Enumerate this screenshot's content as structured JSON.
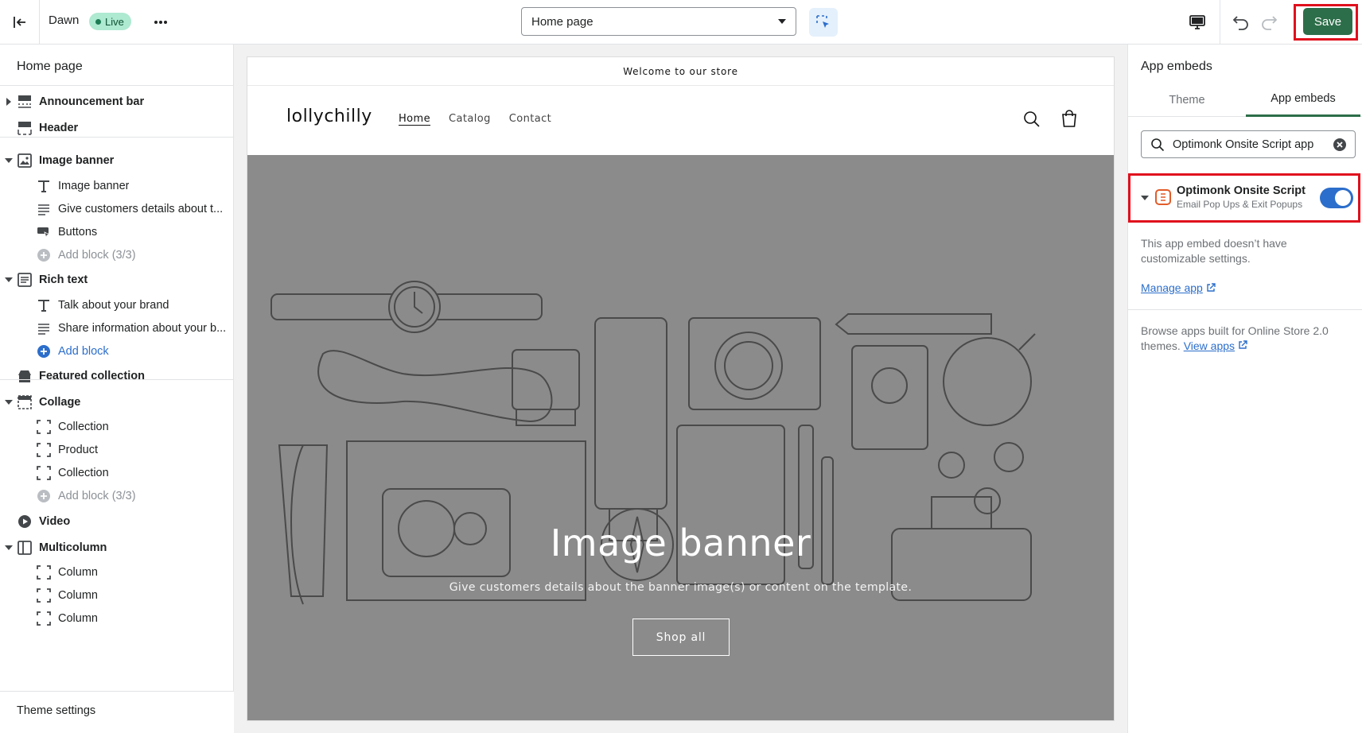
{
  "topbar": {
    "theme_name": "Dawn",
    "status_badge": "Live",
    "page_selector": "Home page",
    "save_label": "Save"
  },
  "sidebar": {
    "title": "Home page",
    "items": [
      {
        "type": "section",
        "label": "Announcement bar",
        "icon": "announcement-bar-icon",
        "arrow": "right"
      },
      {
        "type": "section",
        "label": "Header",
        "icon": "header-icon"
      },
      {
        "type": "section",
        "label": "Image banner",
        "icon": "image-icon",
        "arrow": "down"
      },
      {
        "type": "block",
        "label": "Image banner",
        "icon": "text-icon"
      },
      {
        "type": "block",
        "label": "Give customers details about t...",
        "icon": "paragraph-icon"
      },
      {
        "type": "block",
        "label": "Buttons",
        "icon": "buttons-icon"
      },
      {
        "type": "add",
        "label": "Add block (3/3)",
        "icon": "add-circle-icon"
      },
      {
        "type": "section",
        "label": "Rich text",
        "icon": "rich-text-icon",
        "arrow": "down"
      },
      {
        "type": "block",
        "label": "Talk about your brand",
        "icon": "text-icon"
      },
      {
        "type": "block",
        "label": "Share information about your b...",
        "icon": "paragraph-icon"
      },
      {
        "type": "add-active",
        "label": "Add block",
        "icon": "add-circle-icon"
      },
      {
        "type": "section",
        "label": "Featured collection",
        "icon": "featured-collection-icon"
      },
      {
        "type": "section",
        "label": "Collage",
        "icon": "collage-icon",
        "arrow": "down"
      },
      {
        "type": "block",
        "label": "Collection",
        "icon": "frame-icon"
      },
      {
        "type": "block",
        "label": "Product",
        "icon": "frame-icon"
      },
      {
        "type": "block",
        "label": "Collection",
        "icon": "frame-icon"
      },
      {
        "type": "add",
        "label": "Add block (3/3)",
        "icon": "add-circle-icon"
      },
      {
        "type": "section",
        "label": "Video",
        "icon": "video-icon"
      },
      {
        "type": "section",
        "label": "Multicolumn",
        "icon": "multicolumn-icon",
        "arrow": "down"
      },
      {
        "type": "block",
        "label": "Column",
        "icon": "frame-icon"
      },
      {
        "type": "block",
        "label": "Column",
        "icon": "frame-icon"
      },
      {
        "type": "block",
        "label": "Column",
        "icon": "frame-icon"
      }
    ],
    "theme_settings": "Theme settings"
  },
  "preview": {
    "announcement": "Welcome to our store",
    "store_logo": "lollychilly",
    "nav": [
      "Home",
      "Catalog",
      "Contact"
    ],
    "banner_heading": "Image banner",
    "banner_subtext": "Give customers details about the banner image(s) or content on the template.",
    "banner_button": "Shop all"
  },
  "right_panel": {
    "title": "App embeds",
    "tabs": [
      "Theme",
      "App embeds"
    ],
    "active_tab": "App embeds",
    "search_value": "Optimonk Onsite Script app",
    "embed": {
      "name": "Optimonk Onsite Script",
      "subtitle": "Email Pop Ups & Exit Popups",
      "enabled": true
    },
    "embed_info": "This app embed doesn’t have customizable settings.",
    "manage_link": "Manage app",
    "browse_text": "Browse apps built for Online Store 2.0 themes.",
    "view_apps_link": "View apps"
  },
  "colors": {
    "save_button": "#2c6e49",
    "toggle_on": "#2c6ecb",
    "highlight": "#e0101d",
    "banner_bg": "#8b8b8b"
  }
}
